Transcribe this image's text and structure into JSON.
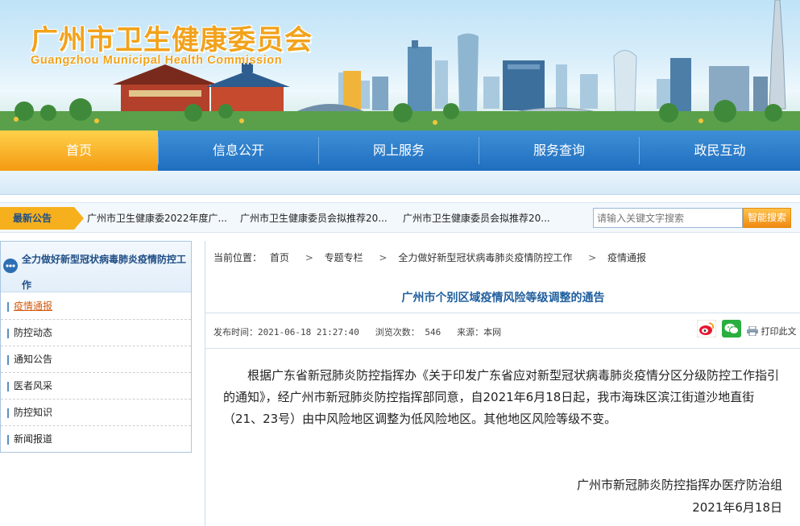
{
  "header": {
    "title_zh": "广州市卫生健康委员会",
    "title_en": "Guangzhou Municipal Health Commission"
  },
  "nav": {
    "items": [
      {
        "label": "首页",
        "active": true
      },
      {
        "label": "信息公开",
        "active": false
      },
      {
        "label": "网上服务",
        "active": false
      },
      {
        "label": "服务查询",
        "active": false
      },
      {
        "label": "政民互动",
        "active": false
      }
    ]
  },
  "notice": {
    "tag": "最新公告",
    "items": [
      "广州市卫生健康委2022年度广...",
      "广州市卫生健康委员会拟推荐20...",
      "广州市卫生健康委员会拟推荐20..."
    ]
  },
  "search": {
    "placeholder": "请输入关键文字搜索",
    "button": "智能搜索"
  },
  "sidebar": {
    "heading": "全力做好新型冠状病毒肺炎疫情防控工作",
    "items": [
      {
        "label": "疫情通报",
        "active": true
      },
      {
        "label": "防控动态",
        "active": false
      },
      {
        "label": "通知公告",
        "active": false
      },
      {
        "label": "医者风采",
        "active": false
      },
      {
        "label": "防控知识",
        "active": false
      },
      {
        "label": "新闻报道",
        "active": false
      }
    ]
  },
  "breadcrumb": {
    "prefix": "当前位置：",
    "items": [
      "首页",
      "专题专栏",
      "全力做好新型冠状病毒肺炎疫情防控工作",
      "疫情通报"
    ],
    "separator": ">"
  },
  "article": {
    "title": "广州市个别区域疫情风险等级调整的通告",
    "meta": {
      "publish_label": "发布时间：",
      "publish_time": "2021-06-18 21:27:40",
      "views_label": "浏览次数：",
      "views": "546",
      "source_label": "来源：",
      "source": "本网"
    },
    "print_label": "打印此文",
    "body": "根据广东省新冠肺炎防控指挥办《关于印发广东省应对新型冠状病毒肺炎疫情分区分级防控工作指引的通知》，经广州市新冠肺炎防控指挥部同意，自2021年6月18日起，我市海珠区滨江街道沙地直街（21、23号）由中风险地区调整为低风险地区。其他地区风险等级不变。",
    "signature": "广州市新冠肺炎防控指挥办医疗防治组",
    "date": "2021年6月18日"
  },
  "colors": {
    "nav_blue": "#1f6ec0",
    "nav_active_orange": "#f49a12",
    "title_blue": "#1f5f9e",
    "brand_orange": "#f2a21b"
  }
}
